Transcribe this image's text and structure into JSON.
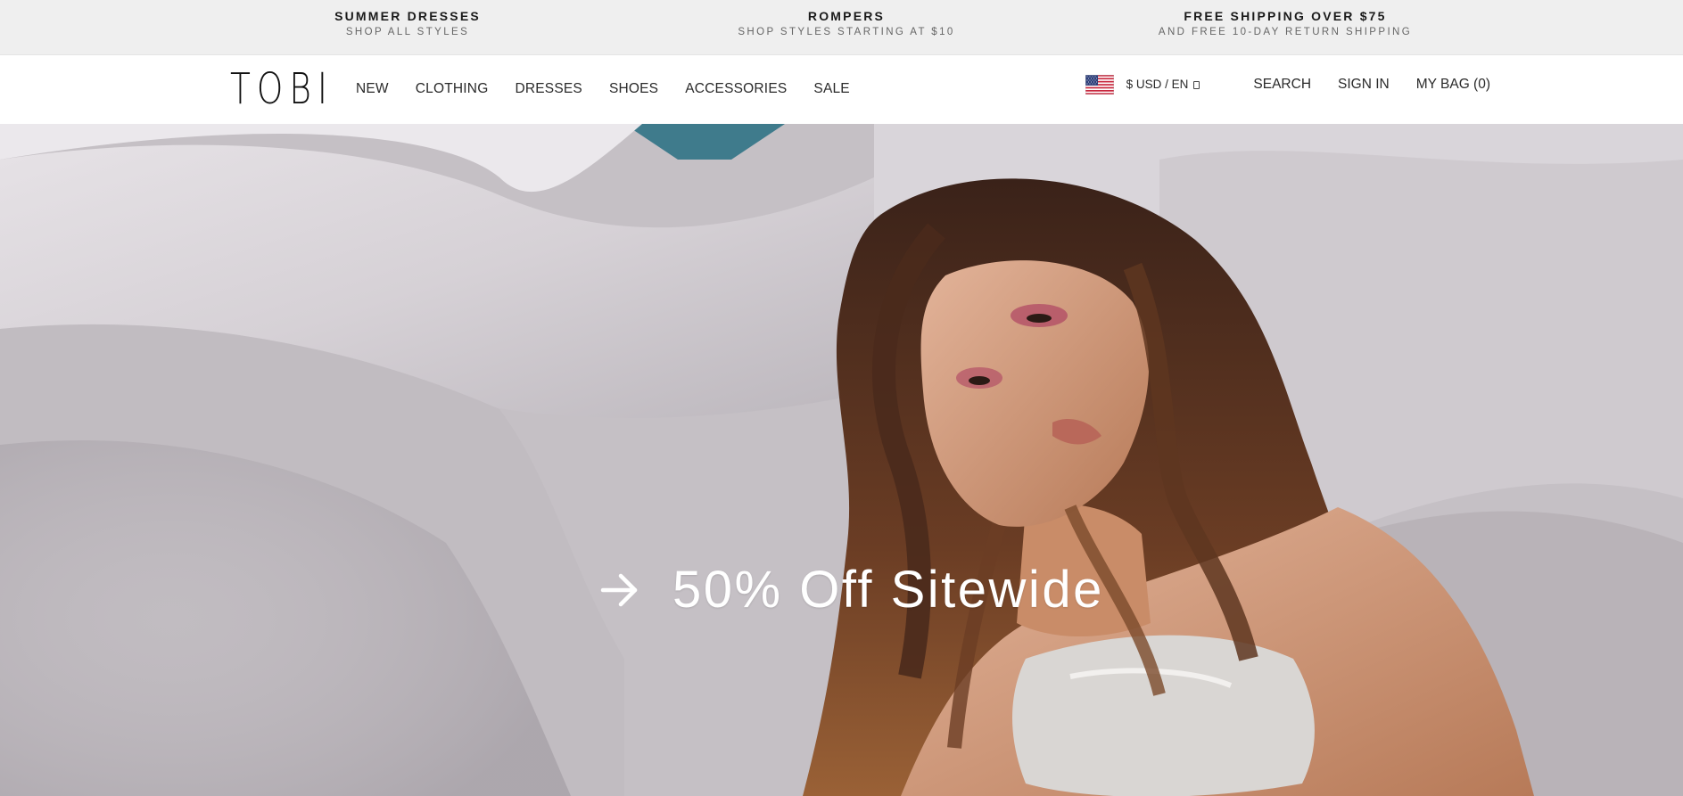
{
  "promos": [
    {
      "title": "SUMMER DRESSES",
      "subtitle": "SHOP ALL STYLES"
    },
    {
      "title": "ROMPERS",
      "subtitle": "SHOP STYLES STARTING AT $10"
    },
    {
      "title": "FREE SHIPPING OVER $75",
      "subtitle": "AND FREE 10-DAY RETURN SHIPPING"
    }
  ],
  "header": {
    "logo": "TOBI",
    "nav": [
      "NEW",
      "CLOTHING",
      "DRESSES",
      "SHOES",
      "ACCESSORIES",
      "SALE"
    ],
    "currency": "$ USD / EN",
    "search": "SEARCH",
    "sign_in": "SIGN IN",
    "bag": "MY BAG (0)",
    "flag_icon": "us-flag-icon"
  },
  "hero": {
    "cta_text": "50% Off Sitewide",
    "cta_icon": "arrow-right-icon"
  },
  "colors": {
    "promo_bg": "#efefef",
    "hero_bg": "#c7c2c6",
    "cta_text": "#ffffff"
  }
}
